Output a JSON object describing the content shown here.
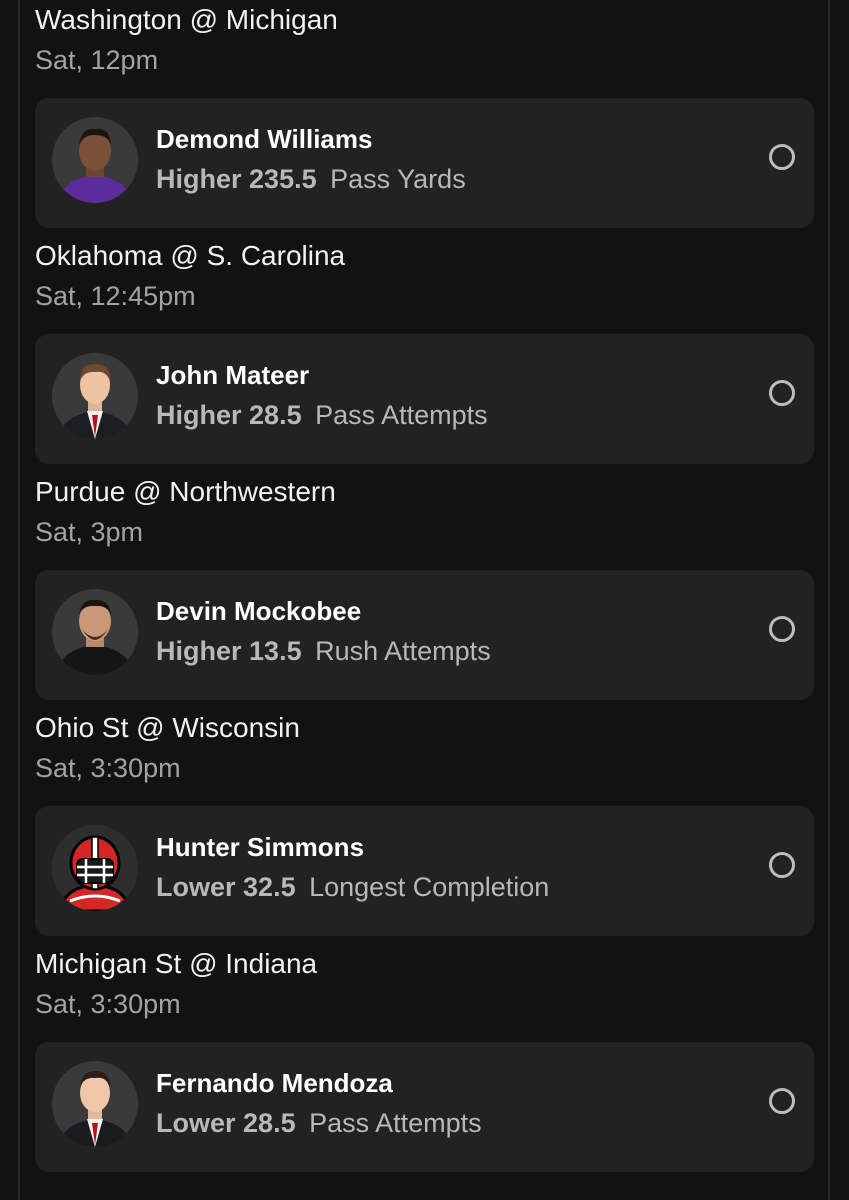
{
  "games": [
    {
      "matchup": "Washington @ Michigan",
      "time": "Sat, 12pm",
      "player": "Demond Williams",
      "direction": "Higher",
      "line": "235.5",
      "stat": "Pass Yards",
      "avatar": "player-photo-purple-jersey"
    },
    {
      "matchup": "Oklahoma @ S. Carolina",
      "time": "Sat, 12:45pm",
      "player": "John Mateer",
      "direction": "Higher",
      "line": "28.5",
      "stat": "Pass Attempts",
      "avatar": "player-photo-suit"
    },
    {
      "matchup": "Purdue @ Northwestern",
      "time": "Sat, 3pm",
      "player": "Devin Mockobee",
      "direction": "Higher",
      "line": "13.5",
      "stat": "Rush Attempts",
      "avatar": "player-photo-black-jersey"
    },
    {
      "matchup": "Ohio St @ Wisconsin",
      "time": "Sat, 3:30pm",
      "player": "Hunter Simmons",
      "direction": "Lower",
      "line": "32.5",
      "stat": "Longest Completion",
      "avatar": "generic-football-player-icon"
    },
    {
      "matchup": "Michigan St @ Indiana",
      "time": "Sat, 3:30pm",
      "player": "Fernando Mendoza",
      "direction": "Lower",
      "line": "28.5",
      "stat": "Pass Attempts",
      "avatar": "player-photo-suit"
    }
  ],
  "colors": {
    "background": "#121212",
    "card": "#222222",
    "muted_text": "#a3a3a3",
    "helmet_red": "#d32626"
  }
}
